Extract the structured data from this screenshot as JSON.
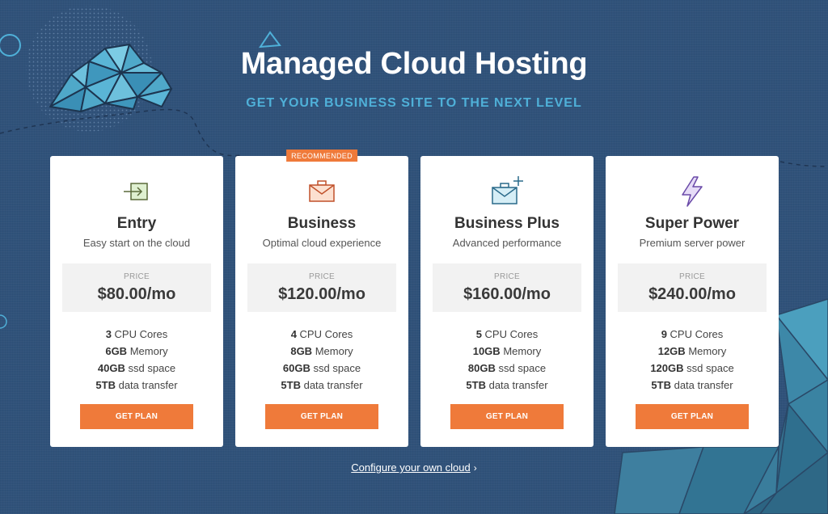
{
  "header": {
    "title": "Managed Cloud Hosting",
    "subtitle": "GET YOUR BUSINESS SITE TO THE NEXT LEVEL"
  },
  "price_label": "PRICE",
  "plans": [
    {
      "name": "Entry",
      "tagline": "Easy start on the cloud",
      "price": "$80.00/mo",
      "icon": "entry-arrow-icon",
      "specs": [
        {
          "value": "3",
          "label": "CPU Cores"
        },
        {
          "value": "6GB",
          "label": "Memory"
        },
        {
          "value": "40GB",
          "label": "ssd space"
        },
        {
          "value": "5TB",
          "label": "data transfer"
        }
      ],
      "cta": "GET PLAN"
    },
    {
      "name": "Business",
      "tagline": "Optimal cloud experience",
      "price": "$120.00/mo",
      "badge": "RECOMMENDED",
      "icon": "briefcase-icon",
      "specs": [
        {
          "value": "4",
          "label": "CPU Cores"
        },
        {
          "value": "8GB",
          "label": "Memory"
        },
        {
          "value": "60GB",
          "label": "ssd space"
        },
        {
          "value": "5TB",
          "label": "data transfer"
        }
      ],
      "cta": "GET PLAN"
    },
    {
      "name": "Business Plus",
      "tagline": "Advanced performance",
      "price": "$160.00/mo",
      "icon": "briefcase-plus-icon",
      "specs": [
        {
          "value": "5",
          "label": "CPU Cores"
        },
        {
          "value": "10GB",
          "label": "Memory"
        },
        {
          "value": "80GB",
          "label": "ssd space"
        },
        {
          "value": "5TB",
          "label": "data transfer"
        }
      ],
      "cta": "GET PLAN"
    },
    {
      "name": "Super Power",
      "tagline": "Premium server power",
      "price": "$240.00/mo",
      "icon": "lightning-icon",
      "specs": [
        {
          "value": "9",
          "label": "CPU Cores"
        },
        {
          "value": "12GB",
          "label": "Memory"
        },
        {
          "value": "120GB",
          "label": "ssd space"
        },
        {
          "value": "5TB",
          "label": "data transfer"
        }
      ],
      "cta": "GET PLAN"
    }
  ],
  "footer": {
    "configure_link": "Configure your own cloud",
    "chevron": "›"
  },
  "colors": {
    "background": "#30527a",
    "accent": "#ef7a3a",
    "subtitle": "#4fb0d8",
    "card": "#ffffff"
  }
}
